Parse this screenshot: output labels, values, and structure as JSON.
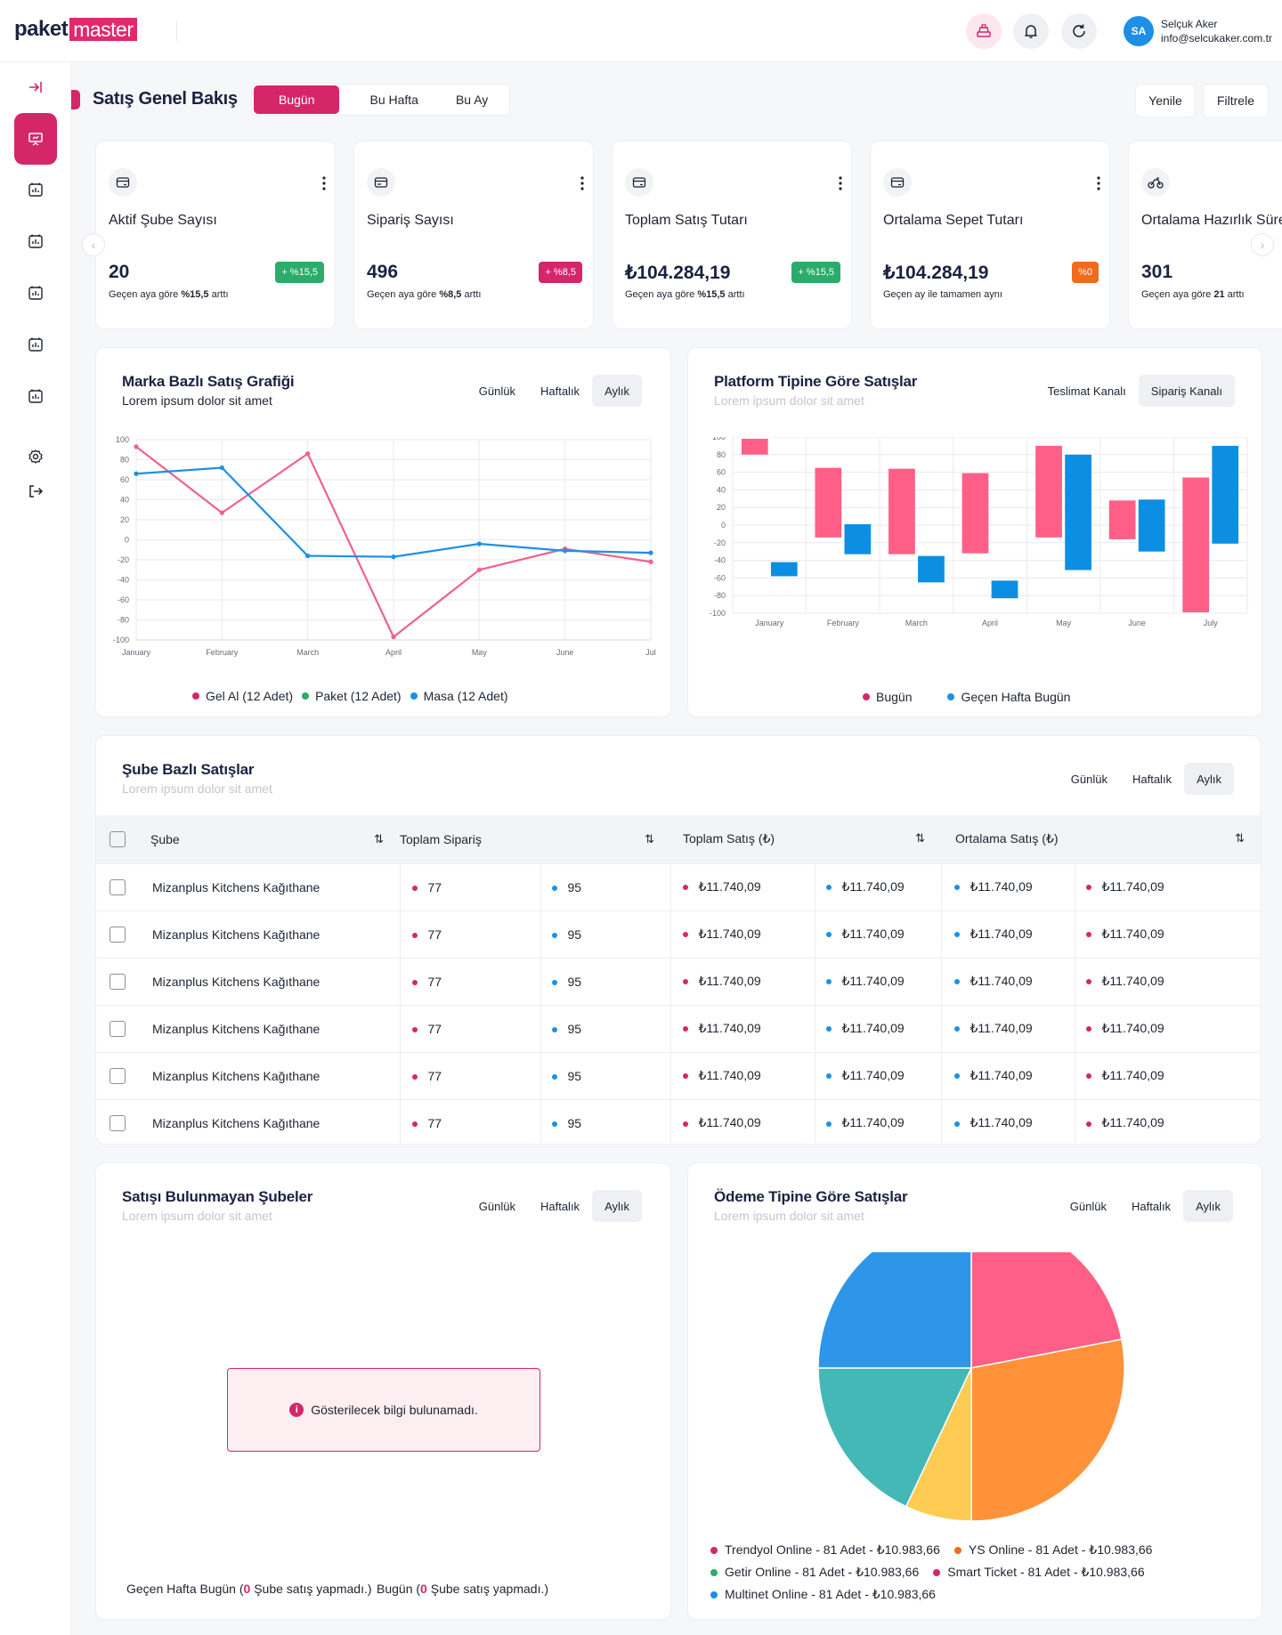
{
  "brand": {
    "logo_part1": "paket",
    "logo_part2": "master"
  },
  "user": {
    "initials": "SA",
    "name": "Selçuk Aker",
    "email": "info@selcukaker.com.tr"
  },
  "page": {
    "title": "Satış Genel Bakış",
    "periods": [
      "Bugün",
      "Bu Hafta",
      "Bu Ay"
    ],
    "active_period": "Bugün",
    "refresh_label": "Yenile",
    "filter_label": "Filtrele"
  },
  "kpis": [
    {
      "title": "Aktif Şube Sayısı",
      "value": "20",
      "badge": "+ %15,5",
      "badge_color": "#2bac6a",
      "sub_pre": "Geçen aya göre ",
      "sub_bold": "%15,5",
      "sub_post": " arttı"
    },
    {
      "title": "Sipariş Sayısı",
      "value": "496",
      "badge": "+ %8,5",
      "badge_color": "#d6266a",
      "sub_pre": "Geçen aya göre ",
      "sub_bold": "%8,5",
      "sub_post": " arttı"
    },
    {
      "title": "Toplam Satış Tutarı",
      "value": "₺104.284,19",
      "badge": "+ %15,5",
      "badge_color": "#2bac6a",
      "sub_pre": "Geçen aya göre ",
      "sub_bold": "%15,5",
      "sub_post": " arttı"
    },
    {
      "title": "Ortalama Sepet Tutarı",
      "value": "₺104.284,19",
      "badge": "%0",
      "badge_color": "#f26a1b",
      "sub_pre": "Geçen ay ile tamamen aynı",
      "sub_bold": "",
      "sub_post": ""
    },
    {
      "title": "Ortalama Hazırlık Süresi",
      "value": "301",
      "badge": "",
      "badge_color": "",
      "sub_pre": "Geçen aya göre ",
      "sub_bold": "21",
      "sub_post": " arttı"
    }
  ],
  "brand_chart": {
    "title": "Marka Bazlı Satış Grafiği",
    "subtitle": "Lorem ipsum dolor sit amet",
    "tabs": [
      "Günlük",
      "Haftalık",
      "Aylık"
    ],
    "active_tab": "Aylık"
  },
  "platform_chart": {
    "title": "Platform Tipine Göre Satışlar",
    "subtitle": "Lorem ipsum dolor sit amet",
    "tabs": [
      "Teslimat Kanalı",
      "Sipariş Kanalı"
    ],
    "active_tab": "Sipariş Kanalı"
  },
  "branch_sales": {
    "title": "Şube Bazlı Satışlar",
    "subtitle": "Lorem ipsum dolor sit amet",
    "tabs": [
      "Günlük",
      "Haftalık",
      "Aylık"
    ],
    "active_tab": "Aylık",
    "columns": [
      "Şube",
      "Toplam Sipariş",
      "Toplam Satış (₺)",
      "Ortalama Satış (₺)"
    ],
    "rows": [
      {
        "branch": "Mizanplus Kitchens Kağıthane",
        "o1": "77",
        "o2": "95",
        "s1": "₺11.740,09",
        "s2": "₺11.740,09",
        "a1": "₺11.740,09",
        "a2": "₺11.740,09"
      },
      {
        "branch": "Mizanplus Kitchens Kağıthane",
        "o1": "77",
        "o2": "95",
        "s1": "₺11.740,09",
        "s2": "₺11.740,09",
        "a1": "₺11.740,09",
        "a2": "₺11.740,09"
      },
      {
        "branch": "Mizanplus Kitchens Kağıthane",
        "o1": "77",
        "o2": "95",
        "s1": "₺11.740,09",
        "s2": "₺11.740,09",
        "a1": "₺11.740,09",
        "a2": "₺11.740,09"
      },
      {
        "branch": "Mizanplus Kitchens Kağıthane",
        "o1": "77",
        "o2": "95",
        "s1": "₺11.740,09",
        "s2": "₺11.740,09",
        "a1": "₺11.740,09",
        "a2": "₺11.740,09"
      },
      {
        "branch": "Mizanplus Kitchens Kağıthane",
        "o1": "77",
        "o2": "95",
        "s1": "₺11.740,09",
        "s2": "₺11.740,09",
        "a1": "₺11.740,09",
        "a2": "₺11.740,09"
      },
      {
        "branch": "Mizanplus Kitchens Kağıthane",
        "o1": "77",
        "o2": "95",
        "s1": "₺11.740,09",
        "s2": "₺11.740,09",
        "a1": "₺11.740,09",
        "a2": "₺11.740,09"
      }
    ]
  },
  "no_sales": {
    "title": "Satışı Bulunmayan Şubeler",
    "subtitle": "Lorem ipsum dolor sit amet",
    "tabs": [
      "Günlük",
      "Haftalık",
      "Aylık"
    ],
    "active_tab": "Aylık",
    "empty_message": "Gösterilecek bilgi bulunamadı.",
    "footer_left_pre": "Geçen Hafta Bugün (",
    "footer_left_num": "0",
    "footer_left_post": " Şube satış yapmadı.)",
    "footer_right_pre": "Bugün (",
    "footer_right_num": "0",
    "footer_right_post": " Şube satış yapmadı.)"
  },
  "payment_chart": {
    "title": "Ödeme Tipine Göre Satışlar",
    "subtitle": "Lorem ipsum dolor sit amet",
    "tabs": [
      "Günlük",
      "Haftalık",
      "Aylık"
    ],
    "active_tab": "Aylık"
  },
  "colors": {
    "accent": "#d6266a",
    "blue": "#1e8fe6",
    "pink": "#f0628a"
  },
  "chart_data": [
    {
      "type": "line",
      "categories": [
        "January",
        "February",
        "March",
        "April",
        "May",
        "June",
        "July"
      ],
      "x_tick_labels": [
        "January",
        "February",
        "March",
        "April",
        "May",
        "June",
        "Jul"
      ],
      "ylim": [
        -100,
        100
      ],
      "yticks": [
        100,
        80,
        60,
        40,
        20,
        0,
        -20,
        -40,
        -60,
        -80,
        -100
      ],
      "grid": true,
      "legend_position": "bottom",
      "series": [
        {
          "name": "Gel Al (12 Adet)",
          "color": "#f0628a",
          "legend_color": "#d6266a",
          "values": [
            93,
            27,
            86,
            -97,
            -30,
            -9,
            -22
          ]
        },
        {
          "name": "Paket (12 Adet)",
          "color": "#2bac6a",
          "legend_color": "#2bac6a",
          "values": []
        },
        {
          "name": "Masa (12 Adet)",
          "color": "#1e8fe6",
          "legend_color": "#1e8fe6",
          "values": [
            66,
            72,
            -16,
            -17,
            -4,
            -11,
            -13
          ]
        }
      ]
    },
    {
      "type": "bar",
      "floating": true,
      "categories": [
        "January",
        "February",
        "March",
        "April",
        "May",
        "June",
        "July"
      ],
      "ylim": [
        -100,
        100
      ],
      "yticks": [
        100,
        80,
        60,
        40,
        20,
        0,
        -20,
        -40,
        -60,
        -80,
        -100
      ],
      "grid": true,
      "legend_position": "bottom",
      "series": [
        {
          "name": "Bugün",
          "color": "#ff5f86",
          "legend_color": "#d6266a",
          "ranges": [
            [
              80,
              98
            ],
            [
              -14,
              65
            ],
            [
              -33,
              64
            ],
            [
              -32,
              59
            ],
            [
              -14,
              90
            ],
            [
              -16,
              28
            ],
            [
              -99,
              54
            ]
          ]
        },
        {
          "name": "Geçen Hafta Bugün",
          "color": "#0c8fe3",
          "legend_color": "#1e8fe6",
          "ranges": [
            [
              -58,
              -42
            ],
            [
              -33,
              1
            ],
            [
              -65,
              -35
            ],
            [
              -83,
              -63
            ],
            [
              -51,
              80
            ],
            [
              -30,
              29
            ],
            [
              -21,
              90
            ]
          ]
        }
      ]
    },
    {
      "type": "pie",
      "legend_position": "bottom",
      "slices": [
        {
          "label": "Trendyol Online - 81 Adet - ₺10.983,66",
          "value": 22,
          "color": "#ff5f86",
          "legend_color": "#d6266a"
        },
        {
          "label": "YS Online - 81 Adet - ₺10.983,66",
          "value": 28,
          "color": "#ff9238",
          "legend_color": "#f26a1b"
        },
        {
          "label": "Smart Ticket - 81 Adet - ₺10.983,66",
          "value": 7,
          "color": "#fecb52",
          "legend_color": "#d6266a"
        },
        {
          "label": "Getir Online - 81 Adet - ₺10.983,66",
          "value": 18,
          "color": "#44b8b6",
          "legend_color": "#2bac6a"
        },
        {
          "label": "Multinet Online - 81 Adet - ₺10.983,66",
          "value": 25,
          "color": "#2e96e8",
          "legend_color": "#1e8fe6"
        }
      ]
    }
  ]
}
